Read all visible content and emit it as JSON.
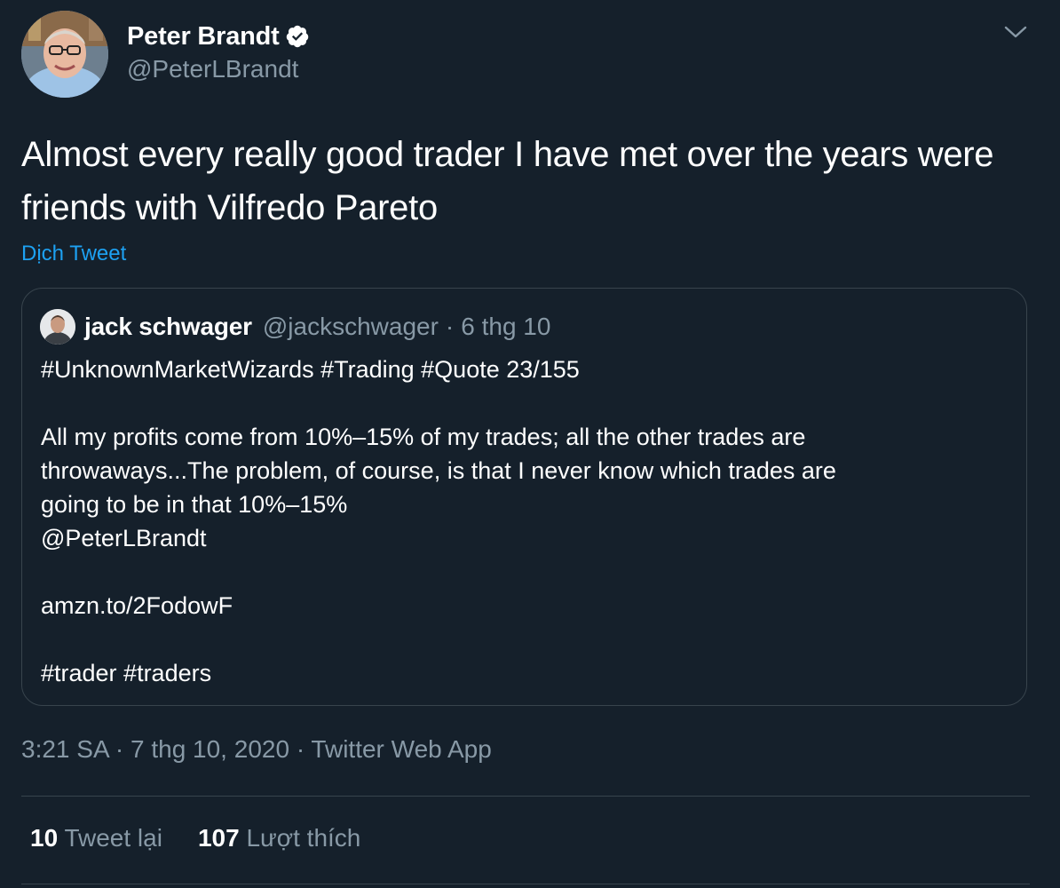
{
  "author": {
    "name": "Peter Brandt",
    "handle": "@PeterLBrandt",
    "verified": true
  },
  "tweet": {
    "text": "Almost every really good trader I have met over the years were friends with Vilfredo Pareto",
    "translate_label": "Dịch Tweet"
  },
  "quoted": {
    "name": "jack schwager",
    "handle": "@jackschwager",
    "separator": "·",
    "date": "6 thg 10",
    "lines": {
      "hashtags_top": "#UnknownMarketWizards #Trading #Quote 23/155",
      "quote_1": "All my profits come from 10%–15% of my trades; all the other trades are",
      "quote_2": "throwaways...The problem, of course, is that I never know which trades are",
      "quote_3": "going to be in that 10%–15%",
      "mention": "@PeterLBrandt",
      "link": "amzn.to/2FodowF",
      "hashtags_bottom": "#trader #traders"
    }
  },
  "meta": {
    "time": "3:21 SA",
    "separator": "·",
    "date": "7 thg 10, 2020",
    "source": "Twitter Web App"
  },
  "stats": {
    "retweets_count": "10",
    "retweets_label": "Tweet lại",
    "likes_count": "107",
    "likes_label": "Lượt thích"
  },
  "colors": {
    "background": "#15202b",
    "text_primary": "#ffffff",
    "text_secondary": "#8899a6",
    "accent": "#1da1f2",
    "border": "#38444d"
  },
  "icons": {
    "verified": "verified-badge-icon",
    "more": "chevron-down-icon"
  }
}
